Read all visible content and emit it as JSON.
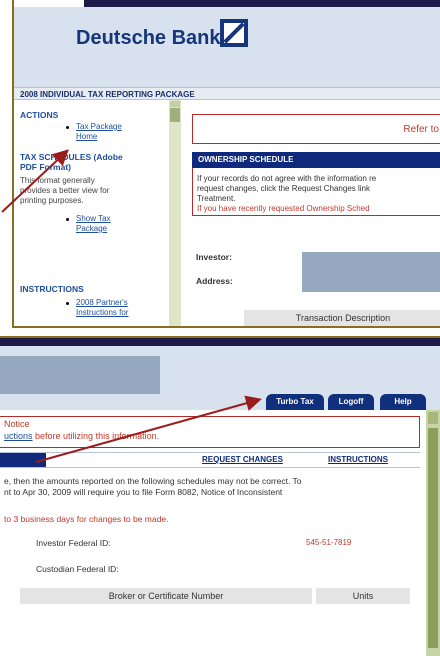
{
  "top_panel": {
    "brand_name": "Deutsche Bank",
    "package_title": "2008 INDIVIDUAL TAX REPORTING PACKAGE",
    "sidebar": {
      "actions_heading": "ACTIONS",
      "tax_package_home_line1": "Tax Package",
      "tax_package_home_line2": "Home",
      "schedules_heading_line1": "TAX SCHEDULES (Adobe",
      "schedules_heading_line2": "PDF Format)",
      "schedules_desc_line1": "This format generally",
      "schedules_desc_line2": "provides a better view for",
      "schedules_desc_line3": "printing purposes.",
      "show_tax_package_line1": "Show Tax",
      "show_tax_package_line2": "Package",
      "instructions_heading": "INSTRUCTIONS",
      "partners_instructions_line1": "2008 Partner's",
      "partners_instructions_line2": "Instructions for"
    },
    "main": {
      "refer_text": "Refer to",
      "ownership_title": "OWNERSHIP SCHEDULE",
      "ownership_line1": "If your records do not agree with the information re",
      "ownership_line2": "request changes, click the Request Changes link",
      "ownership_line3": "Treatment.",
      "ownership_red": "If you have recently requested Ownership Sched",
      "investor_label": "Investor:",
      "address_label": "Address:",
      "transaction_header": "Transaction Description"
    }
  },
  "bottom_panel": {
    "tabs": [
      "Turbo Tax",
      "Logoff",
      "Help"
    ],
    "notice_title": "Notice",
    "notice_link": "uctions",
    "notice_rest": " before utilizing this information.",
    "request_changes": "REQUEST CHANGES",
    "instructions": "INSTRUCTIONS",
    "para_line1": "e, then the amounts reported on the following schedules may not be correct. To",
    "para_line2": "nt to Apr 30, 2009 will require you to file Form 8082, Notice of Inconsistent",
    "red_line": "to 3 business days for changes to be made.",
    "investor_fed_label": "Investor Federal ID:",
    "investor_fed_value": "545-51-7819",
    "custodian_fed_label": "Custodian Federal ID:",
    "broker_header": "Broker or Certificate Number",
    "units_header": "Units"
  },
  "colors": {
    "brand_blue": "#16357a",
    "header_bg": "#d8e2ee",
    "bar_navy": "#0f2a7c",
    "alert_red": "#c0392b",
    "arrow_red": "#9b1c1c"
  }
}
